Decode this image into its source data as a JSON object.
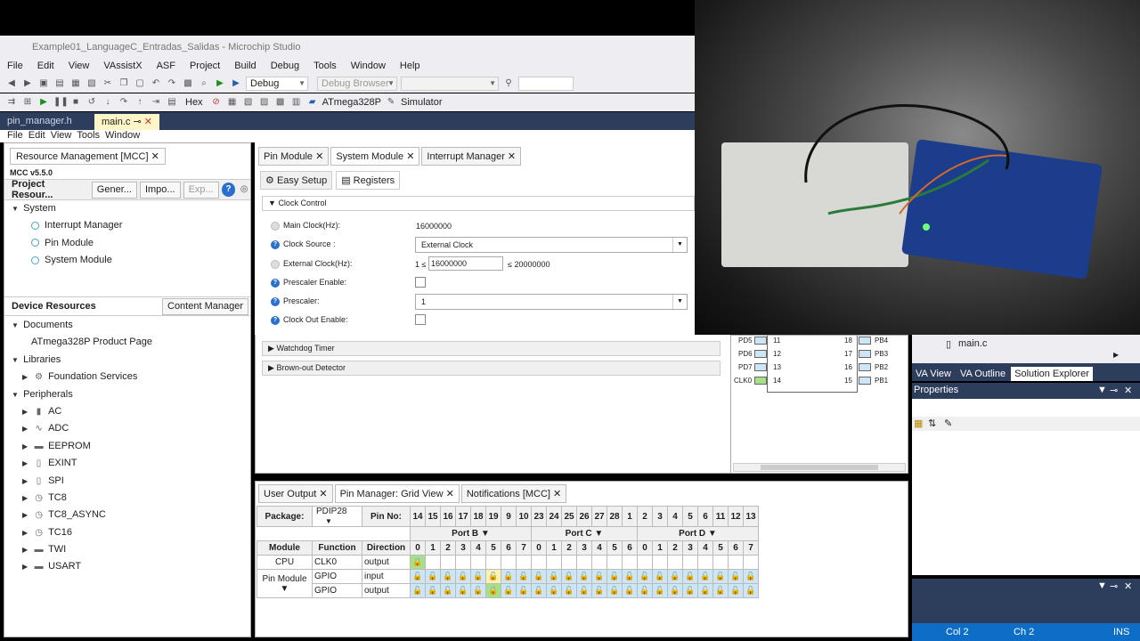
{
  "window": {
    "title": "Example01_LanguageC_Entradas_Salidas - Microchip Studio"
  },
  "menu": [
    "File",
    "Edit",
    "View",
    "VAssistX",
    "ASF",
    "Project",
    "Build",
    "Debug",
    "Tools",
    "Window",
    "Help"
  ],
  "toolbar": {
    "config": "Debug",
    "debug_browser": "Debug Browser",
    "hex": "Hex",
    "device": "ATmega328P",
    "tool": "Simulator"
  },
  "doc_tabs": [
    "pin_manager.h",
    "main.c"
  ],
  "mcc_menu": [
    "File",
    "Edit",
    "View",
    "Tools",
    "Window"
  ],
  "resource_panel": {
    "tab": "Resource Management [MCC]",
    "version": "MCC v5.5.0",
    "project_label": "Project Resour...",
    "btn_generate": "Gener...",
    "btn_import": "Impo...",
    "btn_export": "Exp...",
    "project_tree": {
      "root": "System",
      "items": [
        "Interrupt Manager",
        "Pin Module",
        "System Module"
      ]
    },
    "device_label": "Device Resources",
    "content_manager": "Content Manager",
    "documents": "Documents",
    "product_page": "ATmega328P Product Page",
    "libraries": "Libraries",
    "foundation": "Foundation Services",
    "peripherals": "Peripherals",
    "peripheral_items": [
      "AC",
      "ADC",
      "EEPROM",
      "EXINT",
      "SPI",
      "TC8",
      "TC8_ASYNC",
      "TC16",
      "TWI",
      "USART"
    ]
  },
  "module_tabs": [
    "Pin Module",
    "System Module",
    "Interrupt Manager"
  ],
  "sub_tabs": [
    "Easy Setup",
    "Registers"
  ],
  "clock": {
    "section": "Clock Control",
    "main_clock_label": "Main Clock(Hz):",
    "main_clock_value": "16000000",
    "source_label": "Clock Source :",
    "source_value": "External Clock",
    "ext_label": "External Clock(Hz):",
    "ext_min": "1 ≤",
    "ext_value": "16000000",
    "ext_max": "≤ 20000000",
    "prescaler_enable_label": "Prescaler Enable:",
    "prescaler_label": "Prescaler:",
    "prescaler_value": "1",
    "clock_out_label": "Clock Out Enable:"
  },
  "sections": [
    "Watchdog Timer",
    "Brown-out Detector"
  ],
  "pinout": {
    "left": [
      {
        "name": "PD5",
        "num": "11"
      },
      {
        "name": "PD6",
        "num": "12"
      },
      {
        "name": "PD7",
        "num": "13"
      },
      {
        "name": "CLK0",
        "num": "14"
      }
    ],
    "right": [
      {
        "name": "PB4",
        "num": "18"
      },
      {
        "name": "PB3",
        "num": "17"
      },
      {
        "name": "PB2",
        "num": "16"
      },
      {
        "name": "PB1",
        "num": "15"
      }
    ]
  },
  "right_panel": {
    "file": "main.c",
    "tabs": [
      "VA View",
      "VA Outline",
      "Solution Explorer"
    ],
    "properties": "Properties",
    "status": {
      "col": "Col 2",
      "ch": "Ch 2",
      "ins": "INS"
    }
  },
  "bottom_tabs": [
    "User Output",
    "Pin Manager: Grid View",
    "Notifications [MCC]"
  ],
  "grid": {
    "package_label": "Package:",
    "package_value": "PDIP28",
    "pinno_label": "Pin No:",
    "pin_numbers": [
      "14",
      "15",
      "16",
      "17",
      "18",
      "19",
      "9",
      "10",
      "23",
      "24",
      "25",
      "26",
      "27",
      "28",
      "1",
      "2",
      "3",
      "4",
      "5",
      "6",
      "11",
      "12",
      "13"
    ],
    "port_b": "Port B ▼",
    "port_c": "Port C ▼",
    "port_d": "Port D ▼",
    "col_module": "Module",
    "col_function": "Function",
    "col_direction": "Direction",
    "bits_b": [
      "0",
      "1",
      "2",
      "3",
      "4",
      "5",
      "6",
      "7"
    ],
    "bits_c": [
      "0",
      "1",
      "2",
      "3",
      "4",
      "5",
      "6"
    ],
    "bits_d": [
      "0",
      "1",
      "2",
      "3",
      "4",
      "5",
      "6",
      "7"
    ],
    "rows": [
      {
        "module": "CPU",
        "function": "CLK0",
        "direction": "output"
      },
      {
        "module": "Pin Module ▼",
        "function": "GPIO",
        "direction": "input"
      },
      {
        "module": "",
        "function": "GPIO",
        "direction": "output"
      }
    ]
  },
  "colors": {
    "accent": "#2d3d5c",
    "status": "#0e6ec7",
    "cell": "#cce6f5",
    "cell_active": "#a8e08a"
  }
}
